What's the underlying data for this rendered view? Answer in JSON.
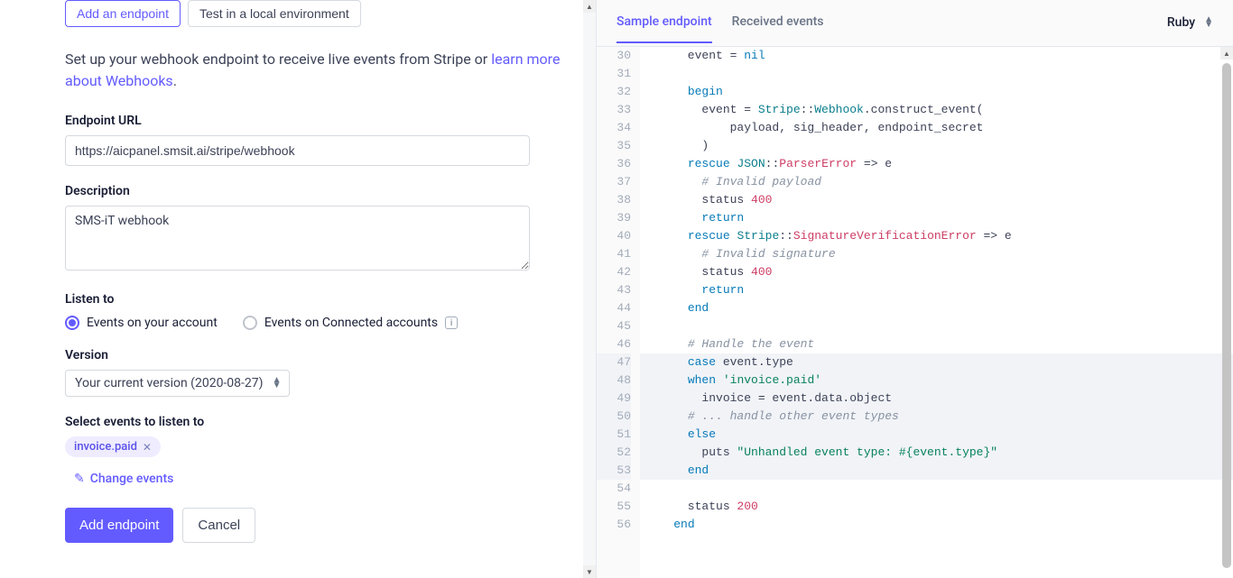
{
  "tabs": {
    "add": "Add an endpoint",
    "test": "Test in a local environment"
  },
  "intro": {
    "line1": "Set up your webhook endpoint to receive live events from Stripe or ",
    "link": "learn more about Webhooks",
    "period": "."
  },
  "endpoint": {
    "label": "Endpoint URL",
    "value": "https://aicpanel.smsit.ai/stripe/webhook"
  },
  "description": {
    "label": "Description",
    "value": "SMS-iT webhook"
  },
  "listen": {
    "label": "Listen to",
    "optionA": "Events on your account",
    "optionB": "Events on Connected accounts"
  },
  "version": {
    "label": "Version",
    "selected": "Your current version (2020-08-27)"
  },
  "events": {
    "label": "Select events to listen to",
    "chip": "invoice.paid",
    "change": "Change events"
  },
  "buttons": {
    "add": "Add endpoint",
    "cancel": "Cancel"
  },
  "right": {
    "tabSample": "Sample endpoint",
    "tabReceived": "Received events",
    "language": "Ruby"
  },
  "code": {
    "start": 30,
    "lines": [
      {
        "t": "      event = ",
        "rest": [
          {
            "c": "kw",
            "t": "nil"
          }
        ]
      },
      {
        "t": ""
      },
      {
        "t": "      ",
        "rest": [
          {
            "c": "kw",
            "t": "begin"
          }
        ]
      },
      {
        "t": "        event = ",
        "rest": [
          {
            "c": "const",
            "t": "Stripe"
          },
          {
            "t": "::"
          },
          {
            "c": "const",
            "t": "Webhook"
          },
          {
            "t": ".construct_event("
          }
        ]
      },
      {
        "t": "            payload, sig_header, endpoint_secret"
      },
      {
        "t": "        )"
      },
      {
        "t": "      ",
        "rest": [
          {
            "c": "kw",
            "t": "rescue"
          },
          {
            "t": " "
          },
          {
            "c": "const",
            "t": "JSON"
          },
          {
            "t": "::"
          },
          {
            "c": "err",
            "t": "ParserError"
          },
          {
            "t": " => e"
          }
        ]
      },
      {
        "t": "        ",
        "rest": [
          {
            "c": "comment",
            "t": "# Invalid payload"
          }
        ]
      },
      {
        "t": "        status ",
        "rest": [
          {
            "c": "num",
            "t": "400"
          }
        ]
      },
      {
        "t": "        ",
        "rest": [
          {
            "c": "kw",
            "t": "return"
          }
        ]
      },
      {
        "t": "      ",
        "rest": [
          {
            "c": "kw",
            "t": "rescue"
          },
          {
            "t": " "
          },
          {
            "c": "const",
            "t": "Stripe"
          },
          {
            "t": "::"
          },
          {
            "c": "err",
            "t": "SignatureVerificationError"
          },
          {
            "t": " => e"
          }
        ]
      },
      {
        "t": "        ",
        "rest": [
          {
            "c": "comment",
            "t": "# Invalid signature"
          }
        ]
      },
      {
        "t": "        status ",
        "rest": [
          {
            "c": "num",
            "t": "400"
          }
        ]
      },
      {
        "t": "        ",
        "rest": [
          {
            "c": "kw",
            "t": "return"
          }
        ]
      },
      {
        "t": "      ",
        "rest": [
          {
            "c": "kw",
            "t": "end"
          }
        ]
      },
      {
        "t": ""
      },
      {
        "t": "      ",
        "rest": [
          {
            "c": "comment",
            "t": "# Handle the event"
          }
        ]
      },
      {
        "hl": true,
        "t": "      ",
        "rest": [
          {
            "c": "kw",
            "t": "case"
          },
          {
            "t": " event.type"
          }
        ]
      },
      {
        "hl": true,
        "t": "      ",
        "rest": [
          {
            "c": "kw",
            "t": "when"
          },
          {
            "t": " "
          },
          {
            "c": "str",
            "t": "'invoice.paid'"
          }
        ]
      },
      {
        "hl": true,
        "t": "        invoice = event.data.object"
      },
      {
        "hl": true,
        "t": "      ",
        "rest": [
          {
            "c": "comment",
            "t": "# ... handle other event types"
          }
        ]
      },
      {
        "hl": true,
        "t": "      ",
        "rest": [
          {
            "c": "kw",
            "t": "else"
          }
        ]
      },
      {
        "hl": true,
        "t": "        puts ",
        "rest": [
          {
            "c": "str",
            "t": "\"Unhandled event type: #{event.type}\""
          }
        ]
      },
      {
        "hl": true,
        "t": "      ",
        "rest": [
          {
            "c": "kw",
            "t": "end"
          }
        ]
      },
      {
        "t": ""
      },
      {
        "t": "      status ",
        "rest": [
          {
            "c": "num",
            "t": "200"
          }
        ]
      },
      {
        "t": "    ",
        "rest": [
          {
            "c": "kw",
            "t": "end"
          }
        ]
      }
    ]
  }
}
